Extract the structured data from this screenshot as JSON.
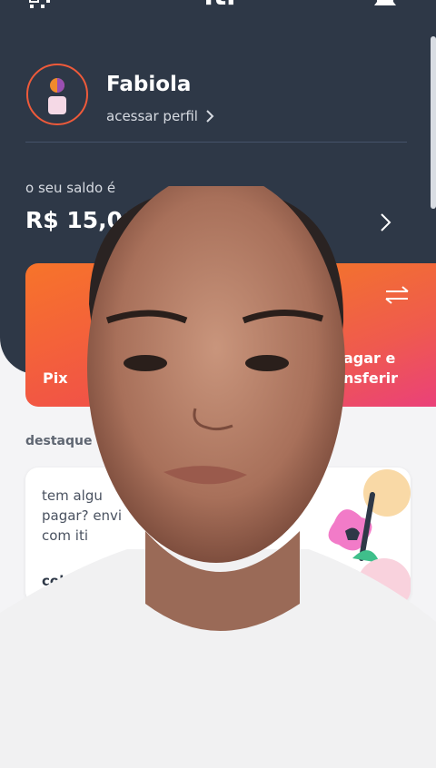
{
  "app": {
    "logo": "iti"
  },
  "icons": {
    "qr": "qr-code-icon",
    "bell": "bell-icon",
    "profile_chevron": "chevron-right-icon",
    "balance_chevron": "chevron-right-icon",
    "transfer": "transfer-arrows-icon"
  },
  "profile": {
    "name": "Fabiola",
    "link_label": "acessar perfil"
  },
  "balance": {
    "label": "o seu saldo é",
    "value": "R$ 15,00"
  },
  "actions": [
    {
      "label": "Pix"
    },
    {
      "label": "pagar e\ntransferir",
      "visible_label": "agar e\nnsferir"
    }
  ],
  "highlights": {
    "section_title": "destaque",
    "card_text": "tem algu\npagar? envi\ncom iti",
    "cta_label": "cobr"
  },
  "colors": {
    "header_bg": "#2e3847",
    "accent_orange": "#f7742a",
    "accent_pink": "#ea3f7c",
    "page_bg": "#f4f4f6"
  }
}
